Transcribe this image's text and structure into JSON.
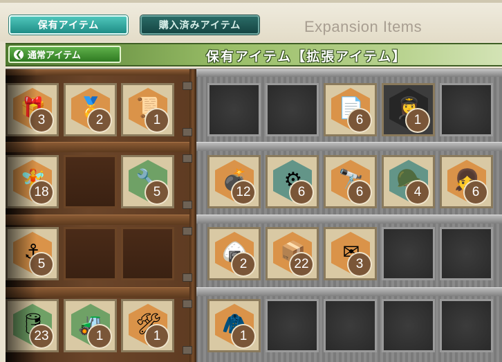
{
  "tabs": [
    {
      "label": "保有アイテム",
      "active": true
    },
    {
      "label": "購入済みアイテム",
      "active": false
    }
  ],
  "expansion_title": "Expansion Items",
  "back_button": {
    "label": "通常アイテム",
    "icon": "chevron-left-icon"
  },
  "section_title": "保有アイテム【拡張アイテム】",
  "colors": {
    "tab_active": "#2fa79e",
    "section_bar": "#7da44a",
    "count_badge": "#7a5638"
  },
  "left_shelf": [
    [
      {
        "icon": "present-box-icon",
        "count": "3"
      },
      {
        "icon": "medal-icon",
        "count": "2"
      },
      {
        "icon": "blueprint-icon",
        "count": "1"
      }
    ],
    [
      {
        "icon": "fairy-icon",
        "count": "18"
      },
      null,
      {
        "icon": "repair-fairy-icon",
        "count": "5"
      }
    ],
    [
      {
        "icon": "sailor-fairy-icon",
        "count": "5"
      },
      null,
      null
    ],
    [
      {
        "icon": "fuel-drum-icon",
        "count": "23"
      },
      {
        "icon": "bulldozer-icon",
        "count": "1"
      },
      {
        "icon": "tools-icon",
        "count": "1"
      }
    ]
  ],
  "right_storage": [
    [
      null,
      null,
      {
        "icon": "documents-icon",
        "count": "6"
      },
      {
        "icon": "pilot-fairy-icon",
        "count": "1"
      },
      null
    ],
    [
      {
        "icon": "artillery-icon",
        "count": "12"
      },
      {
        "icon": "gun-turret-icon",
        "count": "6"
      },
      {
        "icon": "mortar-icon",
        "count": "6"
      },
      {
        "icon": "tank-crew-icon",
        "count": "4"
      },
      {
        "icon": "girl-fairy-icon",
        "count": "6"
      }
    ],
    [
      {
        "icon": "rice-ball-icon",
        "count": "2"
      },
      {
        "icon": "supply-crates-icon",
        "count": "22"
      },
      {
        "icon": "letters-icon",
        "count": "3"
      },
      null,
      null
    ],
    [
      {
        "icon": "blue-tarp-icon",
        "count": "1"
      },
      null,
      null,
      null,
      null
    ]
  ]
}
